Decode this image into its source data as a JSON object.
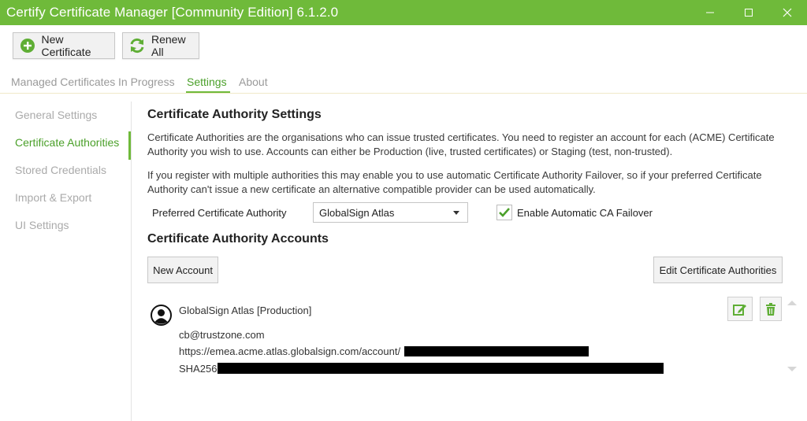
{
  "window": {
    "title": "Certify Certificate Manager [Community Edition] 6.1.2.0",
    "accent": "#6fba3a"
  },
  "toolbar": {
    "new_certificate_label": "New Certificate",
    "new_certificate_icon": "plus-circle-icon",
    "renew_all_label": "Renew All",
    "renew_all_icon": "refresh-icon"
  },
  "tabs": [
    {
      "label": "Managed Certificates",
      "active": false
    },
    {
      "label": "In Progress",
      "active": false
    },
    {
      "label": "Settings",
      "active": true
    },
    {
      "label": "About",
      "active": false
    }
  ],
  "sidebar": {
    "items": [
      {
        "label": "General Settings",
        "active": false
      },
      {
        "label": "Certificate Authorities",
        "active": true
      },
      {
        "label": "Stored Credentials",
        "active": false
      },
      {
        "label": "Import & Export",
        "active": false
      },
      {
        "label": "UI Settings",
        "active": false
      }
    ]
  },
  "main": {
    "heading": "Certificate Authority Settings",
    "para1_line1": "Certificate Authorities are the organisations who can issue trusted certificates. You need to register an account for each (ACME) Certificate",
    "para1_line2": "Authority you wish to use. Accounts can either be Production (live, trusted certificates) or Staging (test, non-trusted).",
    "para2_line1": "If you register with multiple authorities this may enable you to use automatic Certificate Authority Failover, so if your preferred Certificate",
    "para2_line2": "Authority can't issue a new certificate an alternative compatible provider can be used automatically.",
    "preferred_ca_label": "Preferred Certificate Authority",
    "preferred_ca_value": "GlobalSign Atlas",
    "failover_label": "Enable Automatic CA Failover",
    "failover_checked": true,
    "accounts_heading": "Certificate Authority Accounts",
    "new_account_label": "New Account",
    "edit_cas_label": "Edit Certificate Authorities"
  },
  "account": {
    "title": "GlobalSign Atlas [Production]",
    "email": "cb@trustzone.com",
    "url": "https://emea.acme.atlas.globalsign.com/account/",
    "hash_label": "SHA256"
  }
}
